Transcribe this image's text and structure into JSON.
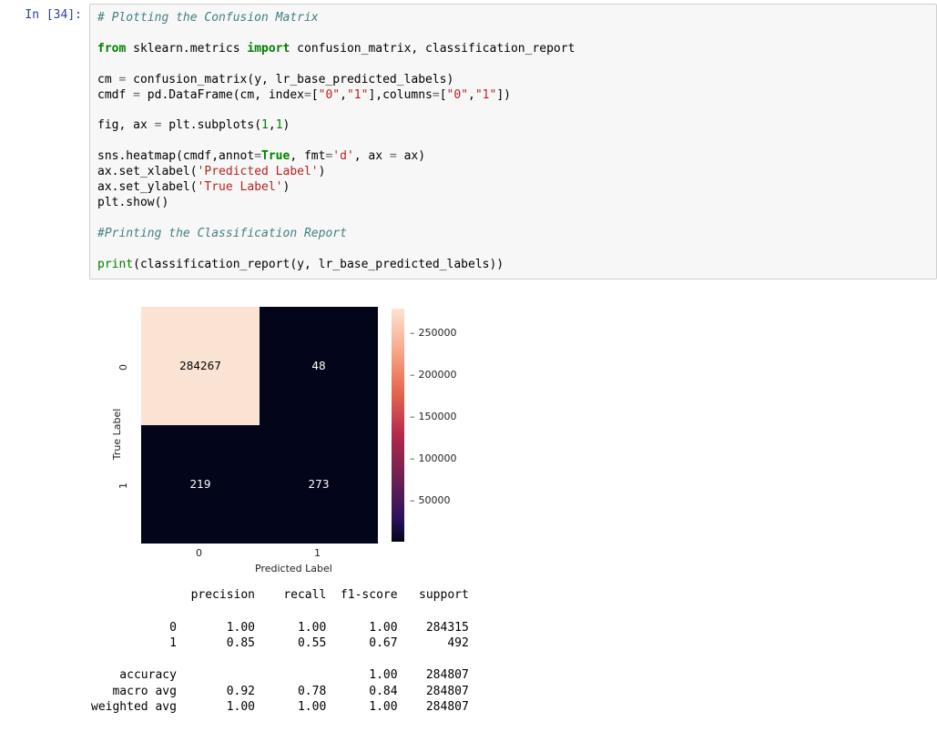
{
  "prompt": "In [34]:",
  "code": {
    "l1_comment": "# Plotting the Confusion Matrix",
    "l2_from": "from",
    "l2_mod": "sklearn.metrics",
    "l2_import": "import",
    "l2_names": "confusion_matrix, classification_report",
    "l3_lhs": "cm ",
    "l3_eq": "=",
    "l3_rhs_a": " confusion_matrix(y, lr_base_predicted_labels)",
    "l4_lhs": "cmdf ",
    "l4_eq": "=",
    "l4_a": " pd.DataFrame(cm, index",
    "l4_eq2": "=",
    "l4_b": "[",
    "l4_s1": "\"0\"",
    "l4_c": ",",
    "l4_s2": "\"1\"",
    "l4_d": "],columns",
    "l4_eq3": "=",
    "l4_e": "[",
    "l4_s3": "\"0\"",
    "l4_f": ",",
    "l4_s4": "\"1\"",
    "l4_g": "])",
    "l5_lhs": "fig, ax ",
    "l5_eq": "=",
    "l5_a": " plt.subplots(",
    "l5_n1": "1",
    "l5_c": ",",
    "l5_n2": "1",
    "l5_b": ")",
    "l6_a": "sns.heatmap(cmdf,annot",
    "l6_eq": "=",
    "l6_true": "True",
    "l6_b": ", fmt",
    "l6_eq2": "=",
    "l6_s": "'d'",
    "l6_c": ", ax ",
    "l6_eq3": "=",
    "l6_d": " ax)",
    "l7_a": "ax.set_xlabel(",
    "l7_s": "'Predicted Label'",
    "l7_b": ")",
    "l8_a": "ax.set_ylabel(",
    "l8_s": "'True Label'",
    "l8_b": ")",
    "l9": "plt.show()",
    "l10_comment": "#Printing the Classification Report",
    "l11_a": "print",
    "l11_b": "(classification_report(y, lr_base_predicted_labels))"
  },
  "chart_data": {
    "type": "heatmap",
    "title": "",
    "xlabel": "Predicted Label",
    "ylabel": "True Label",
    "x_categories": [
      "0",
      "1"
    ],
    "y_categories": [
      "0",
      "1"
    ],
    "values": [
      [
        284267,
        48
      ],
      [
        219,
        273
      ]
    ],
    "colorbar_ticks": [
      "250000",
      "200000",
      "150000",
      "100000",
      "50000"
    ],
    "colorbar_range": [
      0,
      284267
    ]
  },
  "report_header": "              precision    recall  f1-score   support",
  "report_rows": [
    "           0       1.00      1.00      1.00    284315",
    "           1       0.85      0.55      0.67       492"
  ],
  "report_summary": [
    "    accuracy                           1.00    284807",
    "   macro avg       0.92      0.78      0.84    284807",
    "weighted avg       1.00      1.00      1.00    284807"
  ]
}
